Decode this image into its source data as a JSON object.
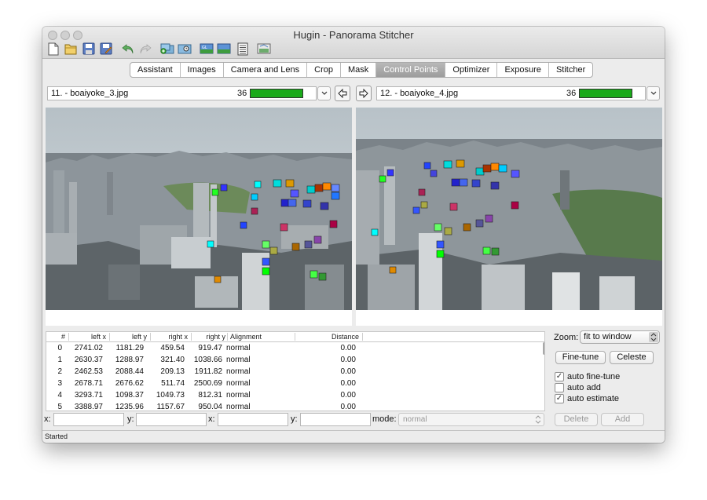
{
  "window": {
    "title": "Hugin - Panorama Stitcher"
  },
  "toolbar": {
    "icons": [
      "new-icon",
      "open-icon",
      "save-icon",
      "save-as-icon",
      "undo-icon",
      "redo-icon",
      "add-images-icon",
      "add-time-series-icon",
      "preview-icon",
      "fast-preview-icon",
      "layout-icon",
      "crop-preview-icon"
    ]
  },
  "tabs": {
    "items": [
      "Assistant",
      "Images",
      "Camera and Lens",
      "Crop",
      "Mask",
      "Control Points",
      "Optimizer",
      "Exposure",
      "Stitcher"
    ],
    "active": "Control Points"
  },
  "left_image": {
    "label": "11. - boaiyoke_3.jpg",
    "count": "36",
    "quality": 1.0
  },
  "right_image": {
    "label": "12. - boaiyoke_4.jpg",
    "count": "36",
    "quality": 1.0
  },
  "left_points": [
    {
      "n": "0",
      "c": "#00ffff"
    },
    {
      "n": "1",
      "c": "#22ff22"
    },
    {
      "n": "2",
      "c": "#3333ff"
    },
    {
      "n": "3",
      "c": "#e08a00"
    },
    {
      "n": "4",
      "c": "#66ff66"
    },
    {
      "n": "5",
      "c": "#2244ff"
    },
    {
      "n": "6",
      "c": "#aa2255"
    },
    {
      "n": "7",
      "c": "#00e000"
    },
    {
      "n": "8",
      "c": "#4444dd"
    },
    {
      "n": "9",
      "c": "#3355ff"
    },
    {
      "n": "10",
      "c": "#cc4455"
    },
    {
      "n": "11",
      "c": "#00dddd"
    },
    {
      "n": "12",
      "c": "#dd9900"
    },
    {
      "n": "13",
      "c": "#00ccff"
    },
    {
      "n": "14",
      "c": "#bb88aa"
    },
    {
      "n": "15",
      "c": "#2222cc"
    },
    {
      "n": "16",
      "c": "#1111aa"
    },
    {
      "n": "17",
      "c": "#aaaa44"
    },
    {
      "n": "18",
      "c": "#00ff00"
    },
    {
      "n": "19",
      "c": "#cc3366"
    },
    {
      "n": "20",
      "c": "#00cccc"
    },
    {
      "n": "21",
      "c": "#aa3300"
    },
    {
      "n": "22",
      "c": "#3344cc"
    },
    {
      "n": "23",
      "c": "#4466ee"
    },
    {
      "n": "24",
      "c": "#8844aa"
    },
    {
      "n": "25",
      "c": "#5555ff"
    },
    {
      "n": "26",
      "c": "#ff8800"
    },
    {
      "n": "27",
      "c": "#66cc33"
    },
    {
      "n": "28",
      "c": "#aa0044"
    },
    {
      "n": "29",
      "c": "#6688ff"
    },
    {
      "n": "30",
      "c": "#aa6600"
    },
    {
      "n": "31",
      "c": "#3333aa"
    },
    {
      "n": "32",
      "c": "#2277ff"
    },
    {
      "n": "33",
      "c": "#44ff44"
    },
    {
      "n": "34",
      "c": "#555599"
    },
    {
      "n": "35",
      "c": "#339933"
    }
  ],
  "table": {
    "columns": [
      "#",
      "left x",
      "left y",
      "right x",
      "right y",
      "Alignment",
      "Distance"
    ],
    "rows": [
      {
        "n": "0",
        "lx": "2741.02",
        "ly": "1181.29",
        "rx": "459.54",
        "ry": "919.47",
        "align": "normal",
        "dist": "0.00"
      },
      {
        "n": "1",
        "lx": "2630.37",
        "ly": "1288.97",
        "rx": "321.40",
        "ry": "1038.66",
        "align": "normal",
        "dist": "0.00"
      },
      {
        "n": "2",
        "lx": "2462.53",
        "ly": "2088.44",
        "rx": "209.13",
        "ry": "1911.82",
        "align": "normal",
        "dist": "0.00"
      },
      {
        "n": "3",
        "lx": "2678.71",
        "ly": "2676.62",
        "rx": "511.74",
        "ry": "2500.69",
        "align": "normal",
        "dist": "0.00"
      },
      {
        "n": "4",
        "lx": "3293.71",
        "ly": "1098.37",
        "rx": "1049.73",
        "ry": "812.31",
        "align": "normal",
        "dist": "0.00"
      },
      {
        "n": "5",
        "lx": "3388.97",
        "ly": "1235.96",
        "rx": "1157.67",
        "ry": "950.04",
        "align": "normal",
        "dist": "0.00"
      }
    ]
  },
  "coords": {
    "x1_label": "x:",
    "y1_label": "y:",
    "x2_label": "x:",
    "y2_label": "y:",
    "mode_label": "mode:",
    "mode_value": "normal"
  },
  "side": {
    "zoom_label": "Zoom:",
    "zoom_value": "fit to window",
    "finetune_label": "Fine-tune",
    "celeste_label": "Celeste",
    "auto_finetune_label": "auto fine-tune",
    "auto_finetune_checked": true,
    "auto_add_label": "auto add",
    "auto_add_checked": false,
    "auto_estimate_label": "auto estimate",
    "auto_estimate_checked": true,
    "delete_label": "Delete",
    "add_label": "Add"
  },
  "status": {
    "text": "Started"
  }
}
